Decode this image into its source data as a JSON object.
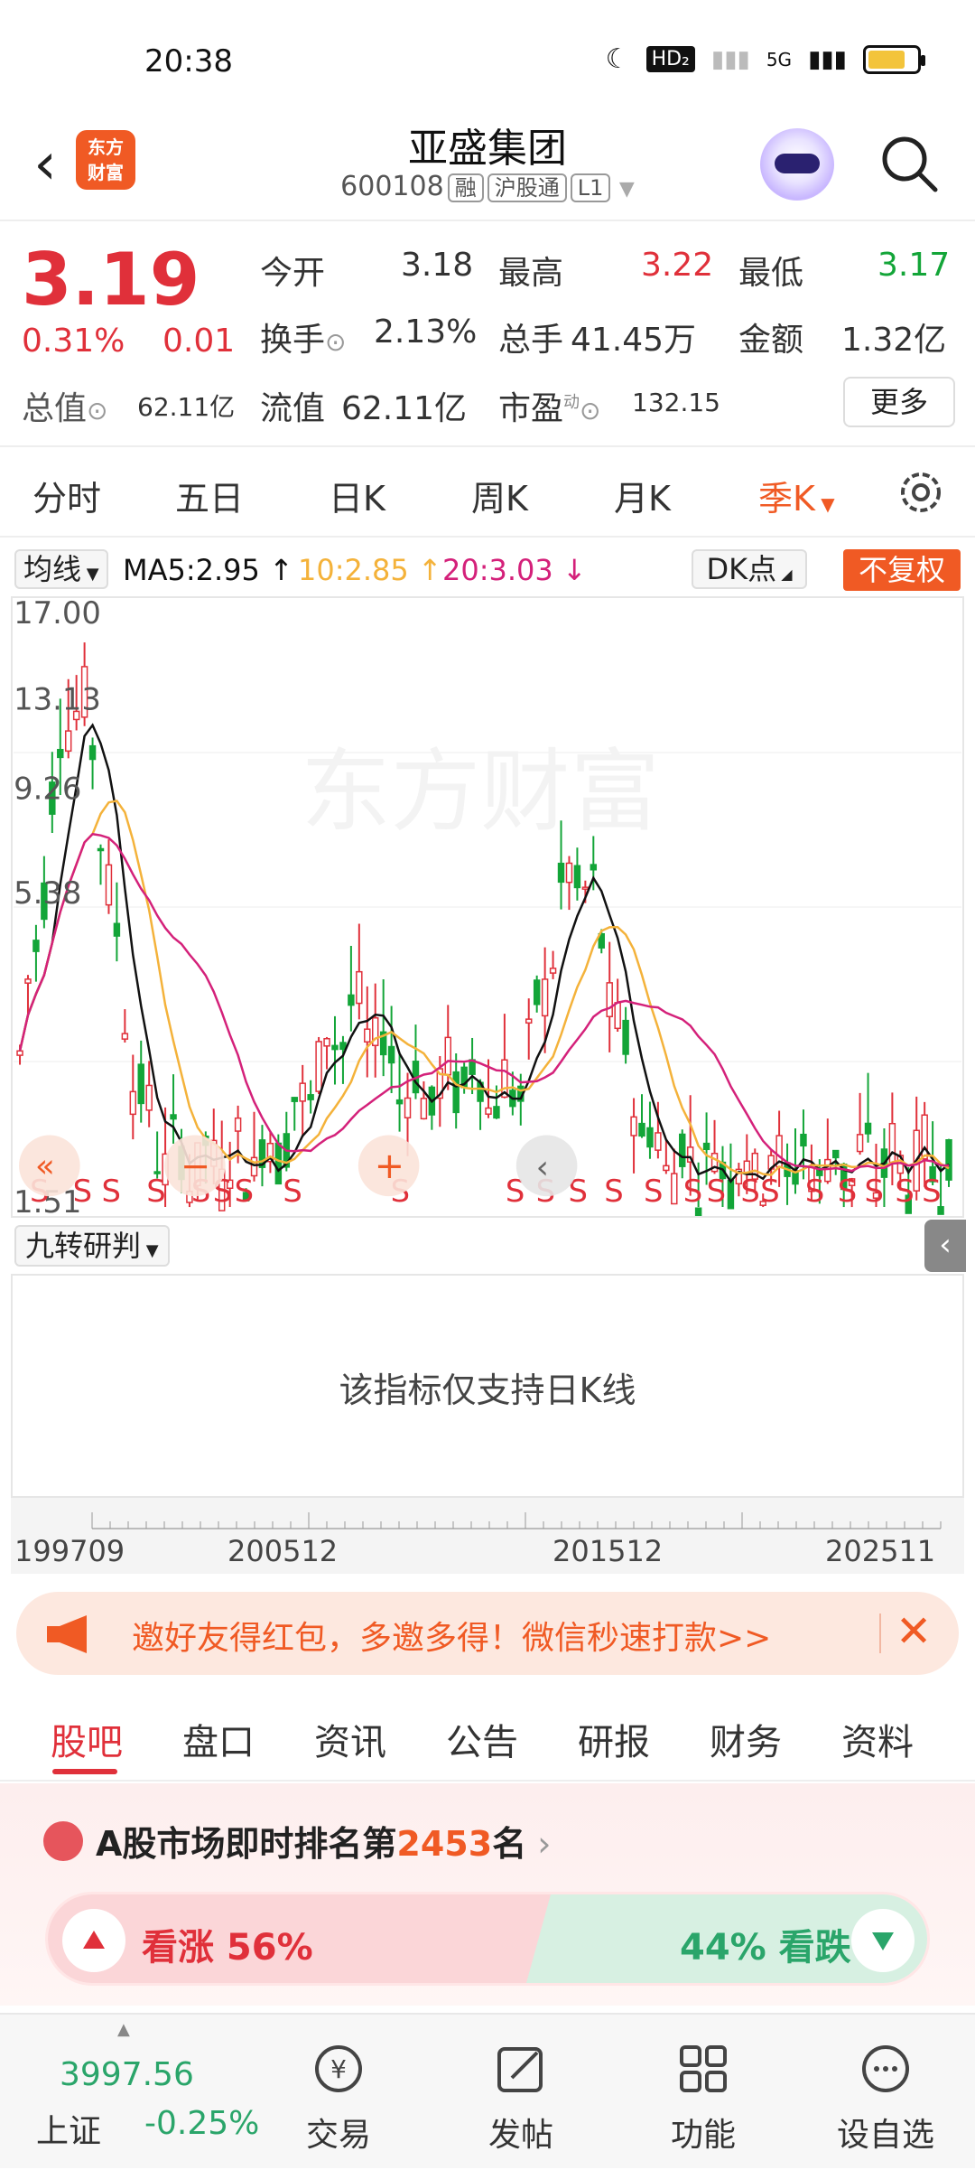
{
  "status": {
    "time": "20:38",
    "hd": "HD₂",
    "net": "5G"
  },
  "header": {
    "back_icon": "back-arrow-icon",
    "logo_line1": "东方",
    "logo_line2": "财富",
    "title": "亚盛集团",
    "code": "600108",
    "tag1": "融",
    "tag2": "沪股通",
    "tag3": "L1"
  },
  "quote": {
    "price": "3.19",
    "pct": "0.31%",
    "change": "0.01",
    "open_label": "今开",
    "open": "3.18",
    "high_label": "最高",
    "high": "3.22",
    "low_label": "最低",
    "low": "3.17",
    "turnover_label": "换手",
    "turnover": "2.13%",
    "volume_label": "总手",
    "volume": "41.45万",
    "amount_label": "金额",
    "amount": "1.32亿",
    "mktcap_label": "总值",
    "mktcap": "62.11亿",
    "float_label": "流值",
    "float": "62.11亿",
    "pe_label": "市盈",
    "pe_sup": "动",
    "pe": "132.15",
    "more": "更多"
  },
  "period_tabs": [
    "分时",
    "五日",
    "日K",
    "周K",
    "月K",
    "季K"
  ],
  "active_period": "季K",
  "ma_bar": {
    "selector": "均线",
    "ma5": "MA5:2.95",
    "ma10": "10:2.85",
    "ma20": "20:3.03",
    "dk": "DK点",
    "adjust": "不复权"
  },
  "chart_data": {
    "type": "candlestick",
    "y_ticks": [
      "17.00",
      "13.13",
      "9.26",
      "5.38",
      "1.51"
    ],
    "x_ticks": [
      "199709",
      "200512",
      "201512",
      "202511"
    ],
    "watermark": "东方财富",
    "signals": [
      "S",
      "S",
      "S",
      "S",
      "S",
      "S",
      "S",
      "S",
      "S",
      "S",
      "S",
      "S",
      "S",
      "S",
      "S",
      "S",
      "S",
      "S",
      "S",
      "S",
      "S",
      "S",
      "S"
    ],
    "colors": {
      "up": "#e0303a",
      "down": "#13a538",
      "ma5": "#111111",
      "ma10": "#f4b23a",
      "ma20": "#d4217a"
    }
  },
  "indicator": {
    "selector": "九转研判",
    "message": "该指标仅支持日K线"
  },
  "banner": {
    "text": "邀好友得红包，多邀多得！微信秒速打款>>"
  },
  "section_tabs": [
    "股吧",
    "盘口",
    "资讯",
    "公告",
    "研报",
    "财务",
    "资料"
  ],
  "active_section": "股吧",
  "rank": {
    "prefix": "A股市场即时排名第",
    "number": "2453",
    "suffix": "名"
  },
  "vote": {
    "up_label": "看涨 56%",
    "down_label": "44% 看跌"
  },
  "bottom_nav": {
    "index_value": "3997.56",
    "index_name": "上证",
    "index_change": "-0.25%",
    "items": [
      "交易",
      "发帖",
      "功能",
      "设自选"
    ]
  }
}
